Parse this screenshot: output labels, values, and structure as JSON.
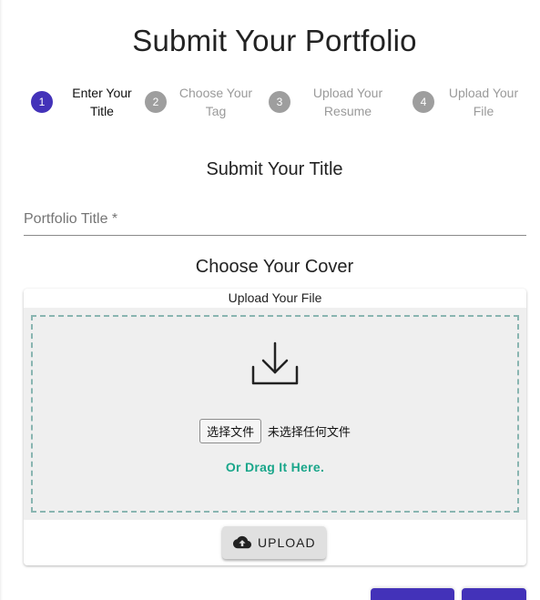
{
  "page": {
    "title": "Submit Your Portfolio"
  },
  "stepper": {
    "steps": [
      {
        "number": "1",
        "label": "Enter Your\nTitle",
        "state": "active"
      },
      {
        "number": "2",
        "label": "Choose Your\nTag",
        "state": "inactive"
      },
      {
        "number": "3",
        "label": "Upload Your\nResume",
        "state": "inactive"
      },
      {
        "number": "4",
        "label": "Upload Your\nFile",
        "state": "inactive"
      }
    ]
  },
  "title_section": {
    "heading": "Submit Your Title",
    "field_label": "Portfolio Title *",
    "field_value": ""
  },
  "cover_section": {
    "heading": "Choose Your Cover",
    "card_title": "Upload Your File",
    "icon": "download-icon",
    "file_button_label": "选择文件",
    "file_status": "未选择任何文件",
    "drag_hint": "Or Drag It Here.",
    "upload_button_icon": "cloud-upload-icon",
    "upload_button_label": "UPLOAD"
  },
  "colors": {
    "accent": "#4332b9",
    "inactive_step": "#9e9e9e",
    "drag_hint": "#19a68a",
    "dashed_border": "#89b5b1",
    "drop_background": "#efefef"
  }
}
